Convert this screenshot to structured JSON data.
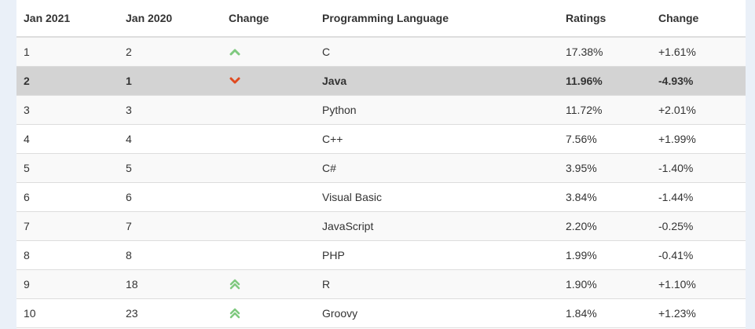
{
  "table": {
    "headers": [
      "Jan 2021",
      "Jan 2020",
      "Change",
      "Programming Language",
      "Ratings",
      "Change"
    ],
    "rows": [
      {
        "rank2021": "1",
        "rank2020": "2",
        "trend": "up",
        "language": "C",
        "rating": "17.38%",
        "change": "+1.61%"
      },
      {
        "rank2021": "2",
        "rank2020": "1",
        "trend": "down",
        "language": "Java",
        "rating": "11.96%",
        "change": "-4.93%"
      },
      {
        "rank2021": "3",
        "rank2020": "3",
        "trend": "none",
        "language": "Python",
        "rating": "11.72%",
        "change": "+2.01%"
      },
      {
        "rank2021": "4",
        "rank2020": "4",
        "trend": "none",
        "language": "C++",
        "rating": "7.56%",
        "change": "+1.99%"
      },
      {
        "rank2021": "5",
        "rank2020": "5",
        "trend": "none",
        "language": "C#",
        "rating": "3.95%",
        "change": "-1.40%"
      },
      {
        "rank2021": "6",
        "rank2020": "6",
        "trend": "none",
        "language": "Visual Basic",
        "rating": "3.84%",
        "change": "-1.44%"
      },
      {
        "rank2021": "7",
        "rank2020": "7",
        "trend": "none",
        "language": "JavaScript",
        "rating": "2.20%",
        "change": "-0.25%"
      },
      {
        "rank2021": "8",
        "rank2020": "8",
        "trend": "none",
        "language": "PHP",
        "rating": "1.99%",
        "change": "-0.41%"
      },
      {
        "rank2021": "9",
        "rank2020": "18",
        "trend": "double-up",
        "language": "R",
        "rating": "1.90%",
        "change": "+1.10%"
      },
      {
        "rank2021": "10",
        "rank2020": "23",
        "trend": "double-up",
        "language": "Groovy",
        "rating": "1.84%",
        "change": "+1.23%"
      }
    ]
  },
  "icons": {
    "up": "chevron-up-icon",
    "down": "chevron-down-icon",
    "double-up": "double-chevron-up-icon"
  },
  "colors": {
    "up": "#7fc97f",
    "down": "#e04a1f",
    "highlight_row": "#d3d3d3"
  }
}
